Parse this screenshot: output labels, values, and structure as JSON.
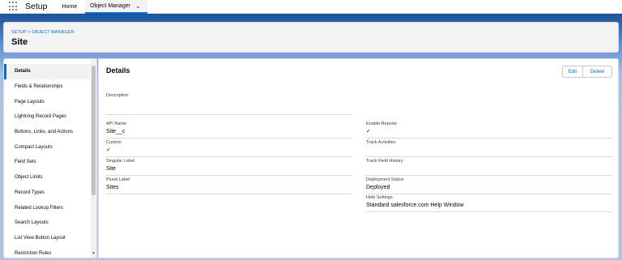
{
  "topnav": {
    "app_name": "Setup",
    "home_label": "Home",
    "object_manager_label": "Object Manager"
  },
  "header": {
    "breadcrumb": "SETUP > OBJECT MANAGER",
    "title": "Site"
  },
  "sidebar": {
    "items": [
      {
        "label": "Details",
        "active": true
      },
      {
        "label": "Fields & Relationships"
      },
      {
        "label": "Page Layouts"
      },
      {
        "label": "Lightning Record Pages"
      },
      {
        "label": "Buttons, Links, and Actions"
      },
      {
        "label": "Compact Layouts"
      },
      {
        "label": "Field Sets"
      },
      {
        "label": "Object Limits"
      },
      {
        "label": "Record Types"
      },
      {
        "label": "Related Lookup Filters"
      },
      {
        "label": "Search Layouts"
      },
      {
        "label": "List View Button Layout"
      },
      {
        "label": "Restriction Rules"
      }
    ]
  },
  "details": {
    "title": "Details",
    "edit_label": "Edit",
    "delete_label": "Delete",
    "description_label": "Description",
    "description_value": "",
    "api_name_label": "API Name",
    "api_name_value": "Site__c",
    "custom_label": "Custom",
    "custom_check": "✓",
    "singular_label_label": "Singular Label",
    "singular_label_value": "Site",
    "plural_label_label": "Plural Label",
    "plural_label_value": "Sites",
    "enable_reports_label": "Enable Reports",
    "enable_reports_check": "✓",
    "track_activities_label": "Track Activities",
    "track_field_history_label": "Track Field History",
    "deployment_status_label": "Deployment Status",
    "deployment_status_value": "Deployed",
    "help_settings_label": "Help Settings",
    "help_settings_value": "Standard salesforce.com Help Window"
  },
  "colors": {
    "brand_blue": "#0070d2",
    "band_blue": "#1b5297"
  }
}
